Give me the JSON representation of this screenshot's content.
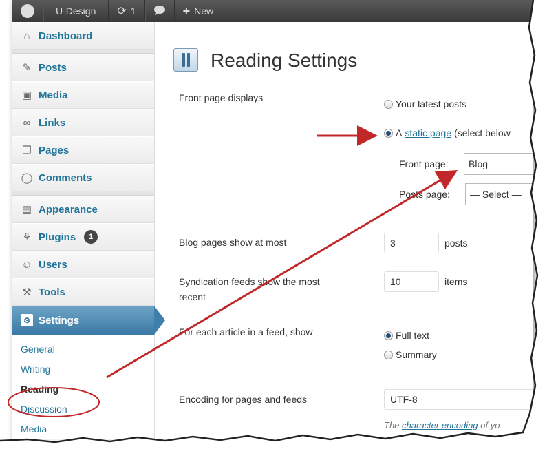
{
  "adminbar": {
    "logo": "W",
    "site_name": "U-Design",
    "updates_count": "1",
    "new_label": "New"
  },
  "sidebar": {
    "items": [
      {
        "label": "Dashboard",
        "icon": "home-icon"
      },
      {
        "label": "Posts",
        "icon": "pin-icon"
      },
      {
        "label": "Media",
        "icon": "media-icon"
      },
      {
        "label": "Links",
        "icon": "link-icon"
      },
      {
        "label": "Pages",
        "icon": "pages-icon"
      },
      {
        "label": "Comments",
        "icon": "comment-icon"
      },
      {
        "label": "Appearance",
        "icon": "appearance-icon"
      },
      {
        "label": "Plugins",
        "icon": "plugin-icon",
        "badge": "1"
      },
      {
        "label": "Users",
        "icon": "users-icon"
      },
      {
        "label": "Tools",
        "icon": "tools-icon"
      },
      {
        "label": "Settings",
        "icon": "settings-icon"
      }
    ],
    "submenu": [
      "General",
      "Writing",
      "Reading",
      "Discussion",
      "Media"
    ]
  },
  "main": {
    "title": "Reading Settings",
    "front_page_displays_label": "Front page displays",
    "latest_posts_label": "Your latest posts",
    "static_page_prefix": "A",
    "static_page_link": "static page",
    "static_page_suffix": "(select below",
    "front_page_label": "Front page:",
    "front_page_value": "Blog",
    "posts_page_label": "Posts page:",
    "posts_page_value": "— Select —",
    "blog_pages_label": "Blog pages show at most",
    "blog_pages_value": "3",
    "blog_pages_unit": "posts",
    "syndication_label_1": "Syndication feeds show the most",
    "syndication_label_2": "recent",
    "syndication_value": "10",
    "syndication_unit": "items",
    "feed_article_label": "For each article in a feed, show",
    "full_text_label": "Full text",
    "summary_label": "Summary",
    "encoding_label": "Encoding for pages and feeds",
    "encoding_value": "UTF-8",
    "encoding_note_prefix": "The",
    "encoding_note_link": "character encoding",
    "encoding_note_suffix": "of yo"
  },
  "colors": {
    "accent": "#21759b",
    "settings_active": "#3f7fab",
    "annotation": "#c0282a"
  }
}
